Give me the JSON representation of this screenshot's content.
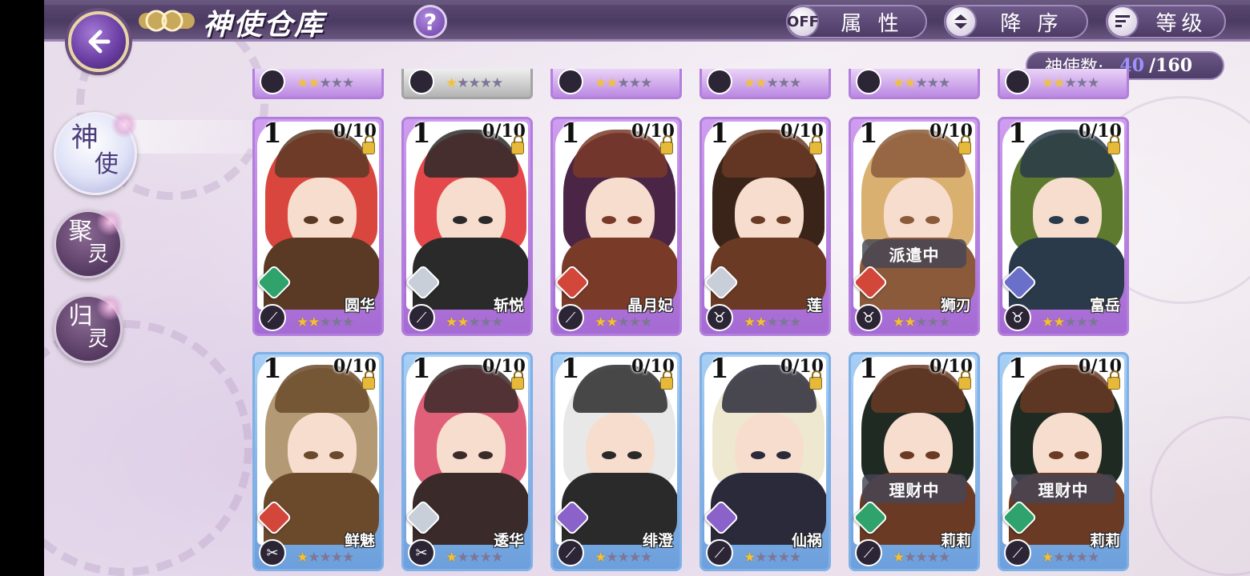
{
  "header": {
    "title": "神使仓库",
    "help_label": "?",
    "filter_toggle": "OFF",
    "filter_label": "属 性",
    "sort_order_label": "降 序",
    "sort_key_label": "等级"
  },
  "count": {
    "label": "神使数:",
    "current": "40",
    "max": "/160"
  },
  "side_nav": [
    {
      "c1": "神",
      "c2": "使",
      "active": true
    },
    {
      "c1": "聚",
      "c2": "灵",
      "active": false
    },
    {
      "c1": "归",
      "c2": "灵",
      "active": false
    }
  ],
  "top_row_partial": [
    {
      "frame": "purple",
      "stars": 2
    },
    {
      "frame": "grey",
      "stars": 1
    },
    {
      "frame": "purple",
      "stars": 2
    },
    {
      "frame": "purple",
      "stars": 2
    },
    {
      "frame": "purple",
      "stars": 2
    },
    {
      "frame": "purple",
      "stars": 2
    }
  ],
  "cards_row1": [
    {
      "level": "1",
      "fragments": "0/10",
      "name": "圆华",
      "element": "green",
      "class_icon": "sword",
      "stars": 2,
      "status": "",
      "hair": "#d9463e",
      "accent": "#5a3a24"
    },
    {
      "level": "1",
      "fragments": "0/10",
      "name": "斩悦",
      "element": "white",
      "class_icon": "sword",
      "stars": 2,
      "status": "",
      "hair": "#e5484a",
      "accent": "#2a2a2a"
    },
    {
      "level": "1",
      "fragments": "0/10",
      "name": "晶月妃",
      "element": "red",
      "class_icon": "sword",
      "stars": 2,
      "status": "",
      "hair": "#4b2546",
      "accent": "#7a3a28"
    },
    {
      "level": "1",
      "fragments": "0/10",
      "name": "莲",
      "element": "white",
      "class_icon": "horns",
      "stars": 2,
      "status": "",
      "hair": "#3a2419",
      "accent": "#6a3a24"
    },
    {
      "level": "1",
      "fragments": "0/10",
      "name": "狮刃",
      "element": "red",
      "class_icon": "horns",
      "stars": 2,
      "status": "派遣中",
      "hair": "#d9b070",
      "accent": "#8a5a3a"
    },
    {
      "level": "1",
      "fragments": "0/10",
      "name": "富岳",
      "element": "blue",
      "class_icon": "horns",
      "stars": 2,
      "status": "",
      "hair": "#5d7a2e",
      "accent": "#2a3a4a"
    }
  ],
  "cards_row2": [
    {
      "level": "1",
      "fragments": "0/10",
      "name": "鲜魅",
      "element": "red",
      "class_icon": "scissors",
      "stars": 1,
      "status": "",
      "hair": "#b39a74",
      "accent": "#6a4a2a"
    },
    {
      "level": "1",
      "fragments": "0/10",
      "name": "逶华",
      "element": "white",
      "class_icon": "scissors",
      "stars": 1,
      "status": "",
      "hair": "#e0607a",
      "accent": "#3a2a2a"
    },
    {
      "level": "1",
      "fragments": "0/10",
      "name": "绯澄",
      "element": "purple",
      "class_icon": "sword",
      "stars": 1,
      "status": "",
      "hair": "#e8e8e8",
      "accent": "#2a2a2a"
    },
    {
      "level": "1",
      "fragments": "0/10",
      "name": "仙祸",
      "element": "purple",
      "class_icon": "sword",
      "stars": 1,
      "status": "",
      "hair": "#efe8d0",
      "accent": "#2a2a3a"
    },
    {
      "level": "1",
      "fragments": "0/10",
      "name": "莉莉",
      "element": "green",
      "class_icon": "sword",
      "stars": 1,
      "status": "理财中",
      "hair": "#1e2a22",
      "accent": "#6a3a24"
    },
    {
      "level": "1",
      "fragments": "0/10",
      "name": "莉莉",
      "element": "green",
      "class_icon": "sword",
      "stars": 1,
      "status": "理财中",
      "hair": "#1e2a22",
      "accent": "#6a3a24"
    }
  ],
  "colors": {
    "element_green": "#2fa36b",
    "element_white": "#c9cfd8",
    "element_red": "#d2473a",
    "element_blue": "#6a70c9",
    "element_purple": "#8a62c9"
  }
}
